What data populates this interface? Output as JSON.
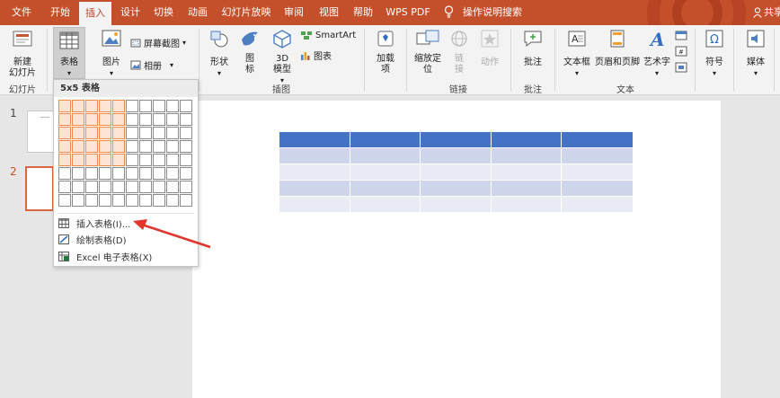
{
  "tabs": [
    {
      "label": "文件"
    },
    {
      "label": "开始"
    },
    {
      "label": "插入"
    },
    {
      "label": "设计"
    },
    {
      "label": "切换"
    },
    {
      "label": "动画"
    },
    {
      "label": "幻灯片放映"
    },
    {
      "label": "审阅"
    },
    {
      "label": "视图"
    },
    {
      "label": "帮助"
    },
    {
      "label": "WPS PDF"
    },
    {
      "label": "操作说明搜索"
    }
  ],
  "share_label": "共享",
  "ribbon": {
    "new_slide": "新建\n幻灯片",
    "table": "表格",
    "picture": "图片",
    "screenshot": "屏幕截图",
    "album": "相册",
    "shapes": "形状",
    "icons": "图\n标",
    "model3d": "3D\n模型",
    "smartart": "SmartArt",
    "chart": "图表",
    "addins": "加载\n项",
    "zoom": "缩放定\n位",
    "link": "链\n接",
    "action": "动作",
    "comment": "批注",
    "textbox": "文本框",
    "header_footer": "页眉和页脚",
    "wordart": "艺术字",
    "symbol": "符号",
    "media": "媒体",
    "groups": {
      "slides": "幻灯片",
      "illustrations": "插图",
      "links": "链接",
      "comments": "批注",
      "text": "文本"
    }
  },
  "dropdown": {
    "title": "5x5 表格",
    "grid_cols": 10,
    "grid_rows": 8,
    "selected_cols": 5,
    "selected_rows": 5,
    "items": [
      {
        "label": "插入表格(I)...",
        "icon": "insert-table-icon"
      },
      {
        "label": "绘制表格(D)",
        "icon": "draw-table-icon"
      },
      {
        "label": "Excel 电子表格(X)",
        "icon": "excel-sheet-icon"
      }
    ]
  },
  "slides": [
    {
      "number": "1"
    },
    {
      "number": "2"
    }
  ],
  "colors": {
    "tabbar": "#c4502b",
    "table_header": "#4472c4",
    "table_band_dark": "#cfd5ea",
    "table_band_light": "#e9ebf5",
    "grid_highlight": "#f08a4b",
    "arrow": "#e0362c"
  },
  "slide_table": {
    "rows": 5,
    "cols": 5
  }
}
